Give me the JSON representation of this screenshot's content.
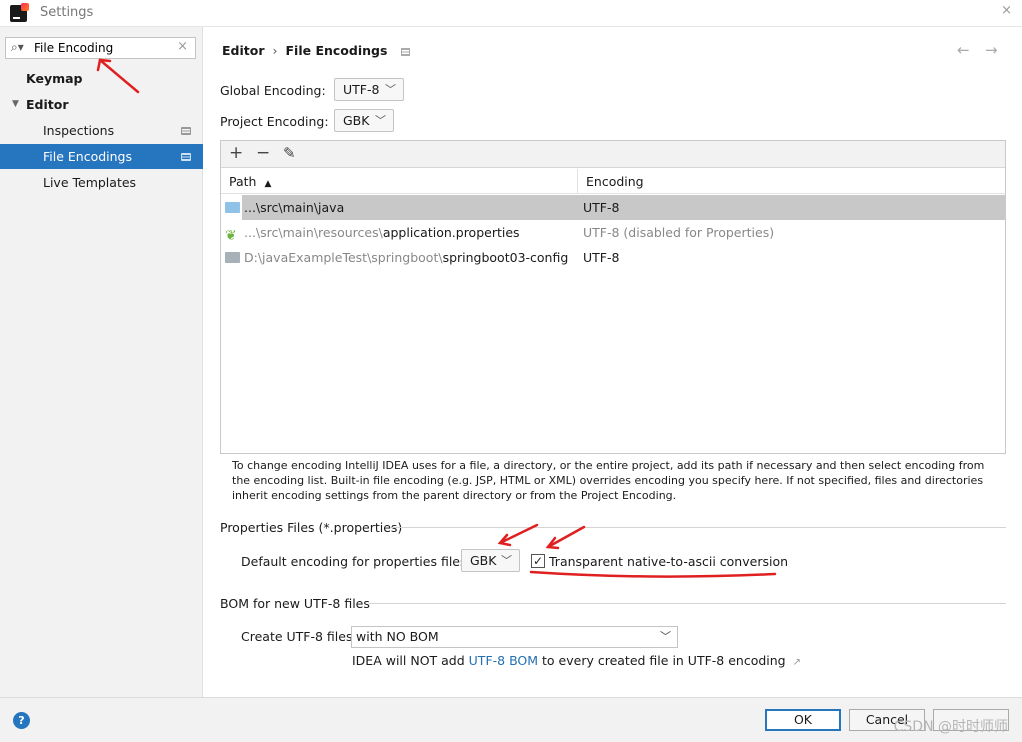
{
  "window": {
    "title": "Settings",
    "close": "×"
  },
  "sidebar": {
    "search_value": "File Encoding",
    "items": [
      {
        "label": "Keymap"
      },
      {
        "label": "Editor"
      },
      {
        "label": "Inspections"
      },
      {
        "label": "File Encodings"
      },
      {
        "label": "Live Templates"
      }
    ]
  },
  "breadcrumb": {
    "parent": "Editor",
    "current": "File Encodings"
  },
  "nav": {
    "back": "←",
    "forward": "→"
  },
  "global_encoding": {
    "label": "Global Encoding:",
    "value": "UTF-8"
  },
  "project_encoding": {
    "label": "Project Encoding:",
    "value": "GBK"
  },
  "toolbar": {
    "add": "+",
    "remove": "−",
    "edit": "✎"
  },
  "table": {
    "col_path": "Path",
    "col_path_sort": "▲",
    "col_encoding": "Encoding",
    "rows": [
      {
        "path_prefix": "...\\src\\main\\java",
        "path_main": "",
        "encoding": "UTF-8"
      },
      {
        "path_prefix": "...\\src\\main\\resources\\",
        "path_main": "application.properties",
        "encoding": "UTF-8 (disabled for Properties)"
      },
      {
        "path_prefix": "D:\\javaExampleTest\\springboot\\",
        "path_main": "springboot03-config",
        "encoding": "UTF-8"
      }
    ]
  },
  "help_text": "To change encoding IntelliJ IDEA uses for a file, a directory, or the entire project, add its path if necessary and then select encoding from the encoding list. Built-in file encoding (e.g. JSP, HTML or XML) overrides encoding you specify here. If not specified, files and directories inherit encoding settings from the parent directory or from the Project Encoding.",
  "properties": {
    "section_title": "Properties Files (*.properties)",
    "default_label": "Default encoding for properties files:",
    "default_value": "GBK",
    "checkbox_label": "Transparent native-to-ascii conversion",
    "checkbox_mark": "✓"
  },
  "bom": {
    "section_title": "BOM for new UTF-8 files",
    "create_label": "Create UTF-8 files:",
    "create_value": "with NO BOM",
    "note_prefix": "IDEA will NOT add ",
    "note_link": "UTF-8 BOM",
    "note_suffix": " to every created file in UTF-8 encoding",
    "note_arrow": "↗"
  },
  "footer": {
    "help": "?",
    "ok": "OK",
    "cancel": "Cancel",
    "watermark": "CSDN @时时师师"
  },
  "colors": {
    "selection": "#2675bf",
    "annotation": "#e02020",
    "link": "#2470b3"
  },
  "icons": [
    "search-icon",
    "clear-icon",
    "chevron-down-icon",
    "page-icon",
    "folder-icon",
    "spring-icon",
    "add-icon",
    "remove-icon",
    "edit-icon",
    "help-icon"
  ]
}
